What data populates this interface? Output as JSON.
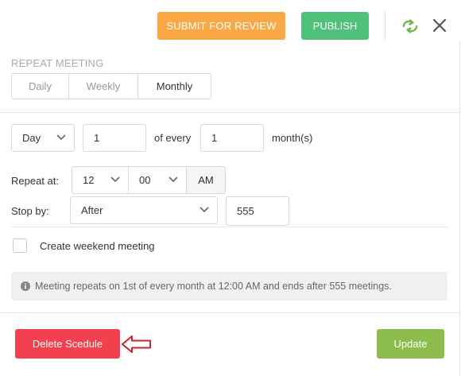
{
  "header": {
    "submit_label": "SUBMIT FOR REVIEW",
    "publish_label": "PUBLISH",
    "sync_icon": "sync-icon",
    "close_icon": "close-icon"
  },
  "repeat": {
    "section_label": "REPEAT MEETING",
    "tabs": [
      {
        "label": "Daily",
        "selected": false
      },
      {
        "label": "Weekly",
        "selected": false
      },
      {
        "label": "Monthly",
        "selected": true
      }
    ]
  },
  "schedule": {
    "unit_value": "Day",
    "day_value": "1",
    "of_every_label": "of every",
    "interval_value": "1",
    "interval_unit_label": "month(s)",
    "repeat_at_label": "Repeat at:",
    "hour_value": "12",
    "minute_value": "00",
    "ampm_value": "AM",
    "stop_by_label": "Stop by:",
    "stop_mode_value": "After",
    "stop_count_value": "555",
    "weekend_label": "Create weekend meeting",
    "weekend_checked": false
  },
  "info_text": "Meeting repeats on 1st of every month at 12:00 AM and ends after 555 meetings.",
  "footer": {
    "delete_label": "Delete Scedule",
    "update_label": "Update"
  },
  "colors": {
    "submit": "#f9a845",
    "publish": "#4fc17a",
    "delete": "#f2404f",
    "update": "#8cbd4c",
    "annotation_arrow": "#d0202a"
  }
}
